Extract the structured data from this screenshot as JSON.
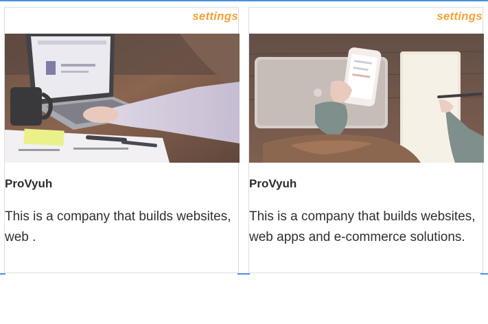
{
  "cards": [
    {
      "settings_label": "settings",
      "title": "ProVyuh",
      "text": "This is a company that builds websites, web .",
      "image_alt": "Person typing on a laptop at a desk with coffee mug and papers"
    },
    {
      "settings_label": "settings",
      "title": "ProVyuh",
      "text": "This is a company that builds websites, web apps and e-commerce solutions.",
      "image_alt": "Person holding a smartphone over a laptop and notebook"
    }
  ],
  "colors": {
    "accent_orange": "#f4a236",
    "rule_blue": "#4a90d9",
    "card_border": "#d9dde1"
  }
}
